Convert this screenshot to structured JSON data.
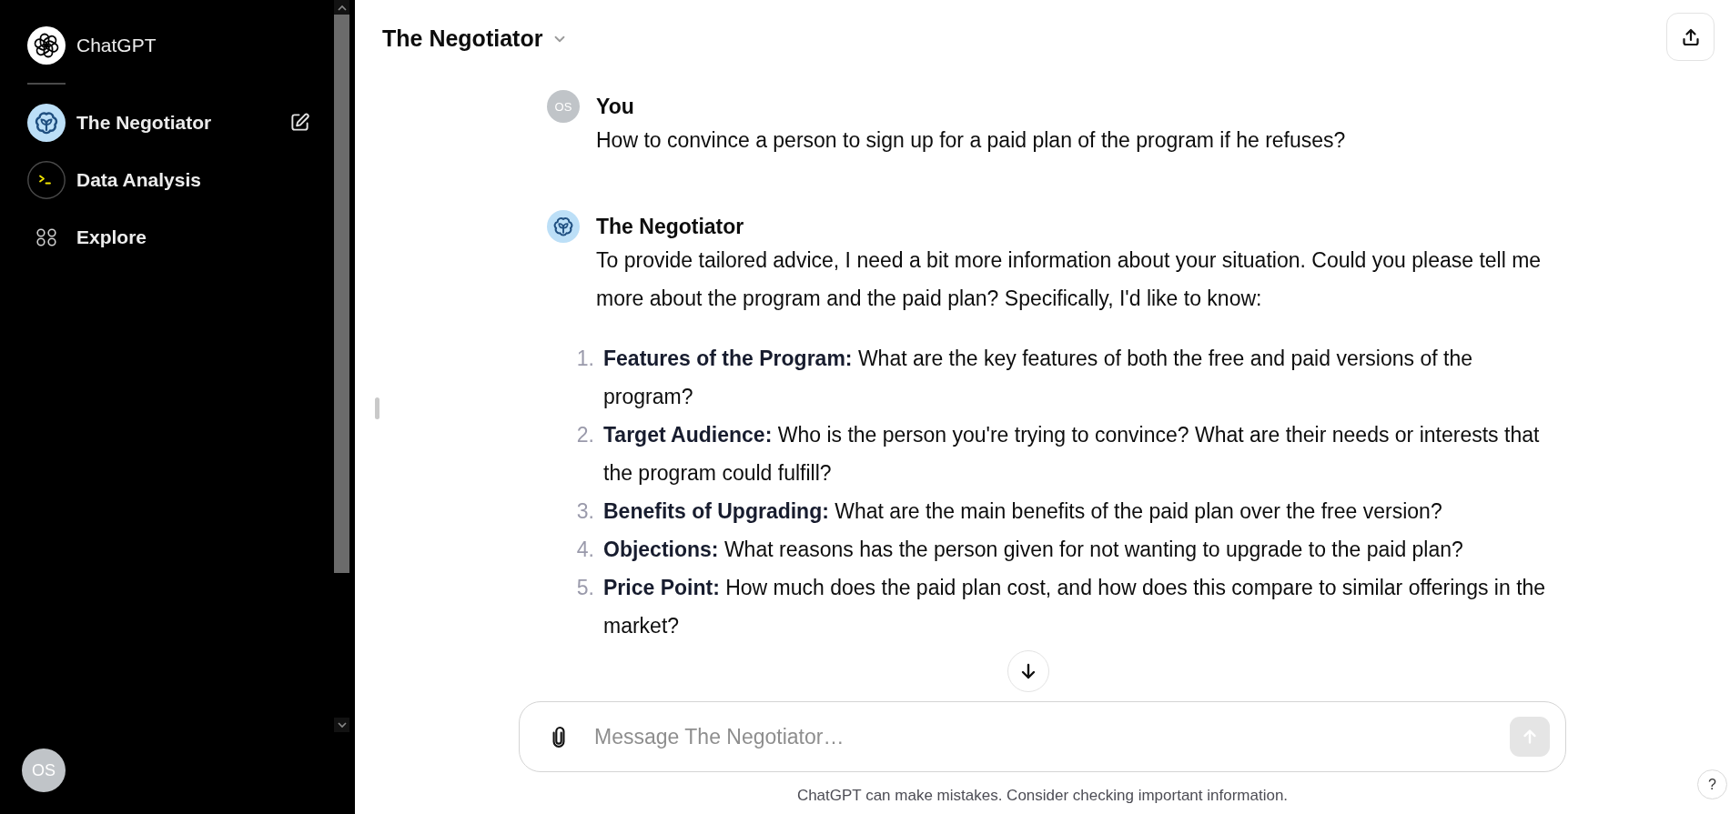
{
  "sidebar": {
    "brand": {
      "label": "ChatGPT"
    },
    "items": [
      {
        "kind": "gpt",
        "label": "The Negotiator",
        "edit_button": true
      },
      {
        "kind": "tool",
        "label": "Data Analysis",
        "edit_button": false
      },
      {
        "kind": "explore",
        "label": "Explore",
        "edit_button": false
      }
    ],
    "user": {
      "initials": "OS"
    }
  },
  "header": {
    "title": "The Negotiator"
  },
  "messages": [
    {
      "kind": "user",
      "author": "You",
      "avatar": "OS",
      "paragraphs": [
        "How to convince a person to sign up for a paid plan of the program if he refuses?"
      ]
    },
    {
      "kind": "gpt",
      "author": "The Negotiator",
      "paragraphs": [
        "To provide tailored advice, I need a bit more information about your situation. Could you please tell me more about the program and the paid plan? Specifically, I'd like to know:"
      ],
      "list": [
        {
          "number": "1.",
          "text": "**Features of the Program:** What are the key features of both the free and paid versions of the program?"
        },
        {
          "number": "2.",
          "text": "**Target Audience:** Who is the person you're trying to convince? What are their needs or interests that the program could fulfill?"
        },
        {
          "number": "3.",
          "text": "**Benefits of Upgrading:** What are the main benefits of the paid plan over the free version?"
        },
        {
          "number": "4.",
          "text": "**Objections:** What reasons has the person given for not wanting to upgrade to the paid plan?"
        },
        {
          "number": "5.",
          "text": "**Price Point:** How much does the paid plan cost, and how does this compare to similar offerings in the market?"
        }
      ]
    }
  ],
  "composer": {
    "placeholder": "Message The Negotiator…",
    "send_disabled": true
  },
  "disclaimer": "ChatGPT can make mistakes. Consider checking important information.",
  "help_button": {
    "label": "?"
  }
}
